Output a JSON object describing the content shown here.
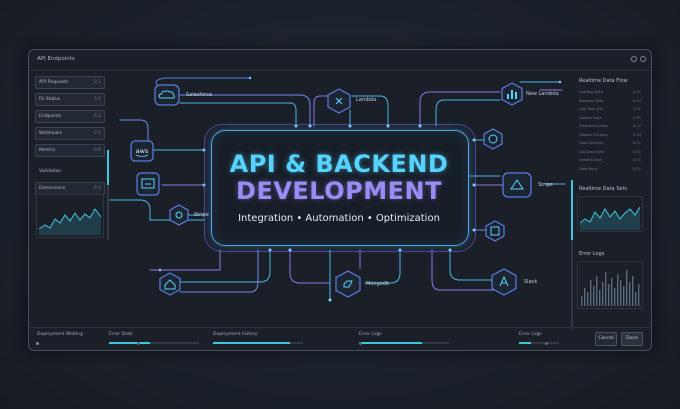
{
  "window": {
    "title": "API Endpoints"
  },
  "left_panel": {
    "items": [
      {
        "label": "API Requests",
        "value": "0.1"
      },
      {
        "label": "Fit Status",
        "value": "0.1"
      },
      {
        "label": "Endpoints",
        "value": "0.2"
      },
      {
        "label": "Webhooks",
        "value": "0.1"
      },
      {
        "label": "Metrics",
        "value": "0.0"
      }
    ],
    "group": [
      {
        "label": "Validation",
        "value": ""
      },
      {
        "label": "Dimensions",
        "value": "0.1"
      }
    ]
  },
  "right_panel": {
    "title1": "Realtime Data Flow",
    "logs": [
      [
        "Loading Data",
        "0.01"
      ],
      [
        "Request Data",
        "0.04"
      ],
      [
        "Log Flow (09)",
        "0.01"
      ],
      [
        "Update Data",
        "0.01"
      ],
      [
        "Scheduled Data",
        "0.07"
      ],
      [
        "Update Schema",
        "0.14"
      ],
      [
        "Data Schema",
        "0.01"
      ],
      [
        "Log Data Sets",
        "0.01"
      ],
      [
        "Update Data",
        "0.01"
      ],
      [
        "Data Runs",
        "0.02"
      ]
    ],
    "title2": "Realtime Data Sets",
    "title3": "Error Logs"
  },
  "hub": {
    "line1": "API & BACKEND",
    "line2": "DEVELOPMENT",
    "tagline": "Integration • Automation • Optimization"
  },
  "nodes": {
    "salesforce": "Salesforce",
    "lambda": "Lambda",
    "new_lambda": "New Lambda",
    "aws": "aws",
    "stripe": "Stripe",
    "stripe_left": "Stripe",
    "mongodb": "Mongodb",
    "slack": "Slack"
  },
  "bottom": {
    "status1": "Deployment Waiting",
    "status2": "Error Stats",
    "status3": "Deployment history",
    "status4": "Error Logs",
    "status5": "Error Logs",
    "progress": [
      0.45,
      0.85,
      0.7,
      0.3
    ],
    "cancel_label": "Cancel",
    "save_label": "Done"
  },
  "colors": {
    "accent": "#3fc6dc",
    "purple": "#9b8cf5",
    "cyan": "#56d3ff"
  }
}
